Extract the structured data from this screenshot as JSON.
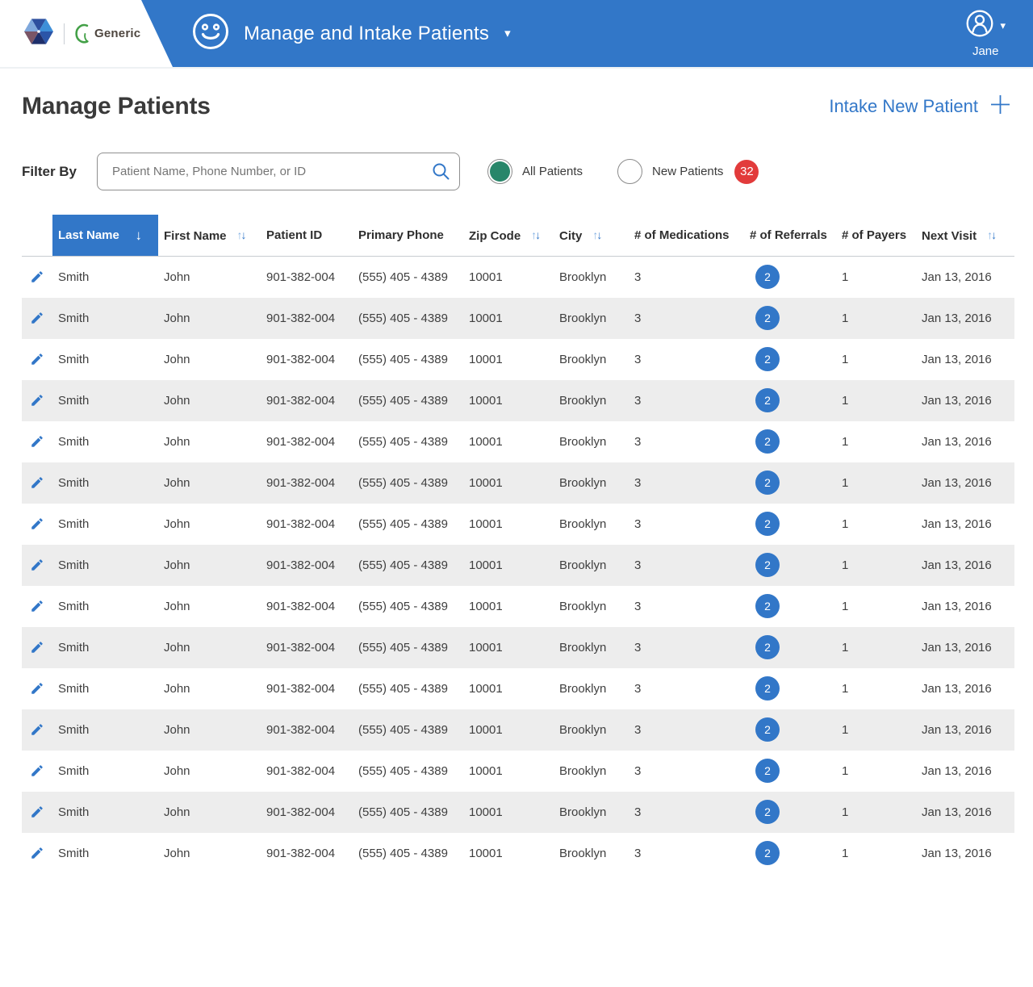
{
  "colors": {
    "accent_blue": "#3277C8",
    "success_green": "#28866A",
    "alert_red": "#E23B3B",
    "row_alt": "#EDEDED"
  },
  "header": {
    "brand": "Generic",
    "app_title": "Manage and Intake Patients",
    "user_name": "Jane"
  },
  "page": {
    "title": "Manage Patients",
    "intake_button": "Intake New Patient"
  },
  "filter": {
    "label": "Filter By",
    "search_placeholder": "Patient Name, Phone Number, or ID",
    "all_patients_label": "All Patients",
    "new_patients_label": "New Patients",
    "new_patients_count": "32"
  },
  "icons": {
    "sort_asc": "↑",
    "sort_desc": "↓",
    "caret_down": "▾"
  },
  "table": {
    "columns": [
      {
        "id": "edit",
        "label": ""
      },
      {
        "id": "last_name",
        "label": "Last Name",
        "sort": "active-desc"
      },
      {
        "id": "first_name",
        "label": "First Name",
        "sort": "sortable"
      },
      {
        "id": "patient_id",
        "label": "Patient ID"
      },
      {
        "id": "primary_phone",
        "label": "Primary Phone"
      },
      {
        "id": "zip",
        "label": "Zip Code",
        "sort": "sortable"
      },
      {
        "id": "city",
        "label": "City",
        "sort": "sortable"
      },
      {
        "id": "medications",
        "label": "# of Medications"
      },
      {
        "id": "referrals",
        "label": "# of Referrals"
      },
      {
        "id": "payers",
        "label": "# of Payers"
      },
      {
        "id": "next_visit",
        "label": "Next Visit",
        "sort": "sortable"
      }
    ],
    "rows": [
      {
        "last_name": "Smith",
        "first_name": "John",
        "patient_id": "901-382-004",
        "primary_phone": "(555) 405 - 4389",
        "zip": "10001",
        "city": "Brooklyn",
        "medications": "3",
        "referrals": "2",
        "payers": "1",
        "next_visit": "Jan 13, 2016"
      },
      {
        "last_name": "Smith",
        "first_name": "John",
        "patient_id": "901-382-004",
        "primary_phone": "(555) 405 - 4389",
        "zip": "10001",
        "city": "Brooklyn",
        "medications": "3",
        "referrals": "2",
        "payers": "1",
        "next_visit": "Jan 13, 2016"
      },
      {
        "last_name": "Smith",
        "first_name": "John",
        "patient_id": "901-382-004",
        "primary_phone": "(555) 405 - 4389",
        "zip": "10001",
        "city": "Brooklyn",
        "medications": "3",
        "referrals": "2",
        "payers": "1",
        "next_visit": "Jan 13, 2016"
      },
      {
        "last_name": "Smith",
        "first_name": "John",
        "patient_id": "901-382-004",
        "primary_phone": "(555) 405 - 4389",
        "zip": "10001",
        "city": "Brooklyn",
        "medications": "3",
        "referrals": "2",
        "payers": "1",
        "next_visit": "Jan 13, 2016"
      },
      {
        "last_name": "Smith",
        "first_name": "John",
        "patient_id": "901-382-004",
        "primary_phone": "(555) 405 - 4389",
        "zip": "10001",
        "city": "Brooklyn",
        "medications": "3",
        "referrals": "2",
        "payers": "1",
        "next_visit": "Jan 13, 2016"
      },
      {
        "last_name": "Smith",
        "first_name": "John",
        "patient_id": "901-382-004",
        "primary_phone": "(555) 405 - 4389",
        "zip": "10001",
        "city": "Brooklyn",
        "medications": "3",
        "referrals": "2",
        "payers": "1",
        "next_visit": "Jan 13, 2016"
      },
      {
        "last_name": "Smith",
        "first_name": "John",
        "patient_id": "901-382-004",
        "primary_phone": "(555) 405 - 4389",
        "zip": "10001",
        "city": "Brooklyn",
        "medications": "3",
        "referrals": "2",
        "payers": "1",
        "next_visit": "Jan 13, 2016"
      },
      {
        "last_name": "Smith",
        "first_name": "John",
        "patient_id": "901-382-004",
        "primary_phone": "(555) 405 - 4389",
        "zip": "10001",
        "city": "Brooklyn",
        "medications": "3",
        "referrals": "2",
        "payers": "1",
        "next_visit": "Jan 13, 2016"
      },
      {
        "last_name": "Smith",
        "first_name": "John",
        "patient_id": "901-382-004",
        "primary_phone": "(555) 405 - 4389",
        "zip": "10001",
        "city": "Brooklyn",
        "medications": "3",
        "referrals": "2",
        "payers": "1",
        "next_visit": "Jan 13, 2016"
      },
      {
        "last_name": "Smith",
        "first_name": "John",
        "patient_id": "901-382-004",
        "primary_phone": "(555) 405 - 4389",
        "zip": "10001",
        "city": "Brooklyn",
        "medications": "3",
        "referrals": "2",
        "payers": "1",
        "next_visit": "Jan 13, 2016"
      },
      {
        "last_name": "Smith",
        "first_name": "John",
        "patient_id": "901-382-004",
        "primary_phone": "(555) 405 - 4389",
        "zip": "10001",
        "city": "Brooklyn",
        "medications": "3",
        "referrals": "2",
        "payers": "1",
        "next_visit": "Jan 13, 2016"
      },
      {
        "last_name": "Smith",
        "first_name": "John",
        "patient_id": "901-382-004",
        "primary_phone": "(555) 405 - 4389",
        "zip": "10001",
        "city": "Brooklyn",
        "medications": "3",
        "referrals": "2",
        "payers": "1",
        "next_visit": "Jan 13, 2016"
      },
      {
        "last_name": "Smith",
        "first_name": "John",
        "patient_id": "901-382-004",
        "primary_phone": "(555) 405 - 4389",
        "zip": "10001",
        "city": "Brooklyn",
        "medications": "3",
        "referrals": "2",
        "payers": "1",
        "next_visit": "Jan 13, 2016"
      },
      {
        "last_name": "Smith",
        "first_name": "John",
        "patient_id": "901-382-004",
        "primary_phone": "(555) 405 - 4389",
        "zip": "10001",
        "city": "Brooklyn",
        "medications": "3",
        "referrals": "2",
        "payers": "1",
        "next_visit": "Jan 13, 2016"
      },
      {
        "last_name": "Smith",
        "first_name": "John",
        "patient_id": "901-382-004",
        "primary_phone": "(555) 405 - 4389",
        "zip": "10001",
        "city": "Brooklyn",
        "medications": "3",
        "referrals": "2",
        "payers": "1",
        "next_visit": "Jan 13, 2016"
      }
    ]
  }
}
